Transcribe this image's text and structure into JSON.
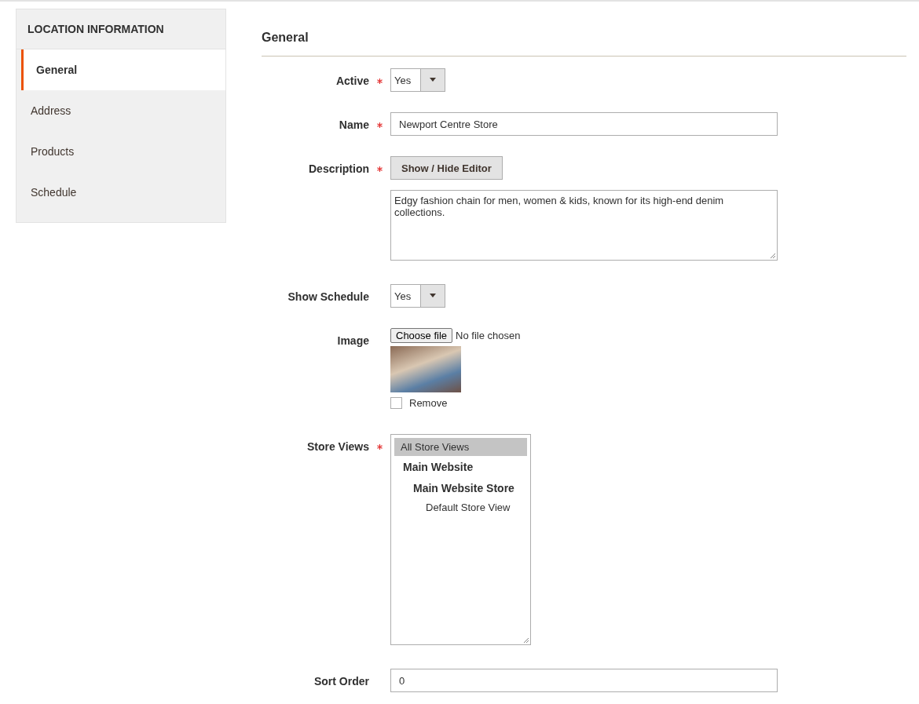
{
  "sidebar": {
    "title": "LOCATION INFORMATION",
    "items": [
      {
        "label": "General",
        "selected": true
      },
      {
        "label": "Address",
        "selected": false
      },
      {
        "label": "Products",
        "selected": false
      },
      {
        "label": "Schedule",
        "selected": false
      }
    ]
  },
  "section": {
    "title": "General"
  },
  "fields": [
    {
      "kind": "select",
      "label": "Active",
      "required": true,
      "value": "Yes"
    },
    {
      "kind": "text",
      "label": "Name",
      "required": true,
      "value": "Newport Centre Store"
    },
    {
      "kind": "editor",
      "label": "Description",
      "required": true,
      "button": "Show / Hide Editor",
      "value": "Edgy fashion chain for men, women & kids, known for its high-end denim collections."
    },
    {
      "kind": "select",
      "label": "Show Schedule",
      "required": false,
      "value": "Yes"
    },
    {
      "kind": "file",
      "label": "Image",
      "required": false,
      "button": "Choose file",
      "status": "No file chosen",
      "remove": {
        "label": "Remove",
        "checked": false
      }
    },
    {
      "kind": "multiselect",
      "label": "Store Views",
      "required": true,
      "options": [
        {
          "kind": "option",
          "label": "All Store Views",
          "selected": true
        },
        {
          "kind": "group",
          "label": "Main Website",
          "children": [
            {
              "kind": "group",
              "label": "Main Website Store",
              "children": [
                {
                  "kind": "option",
                  "label": "Default Store View",
                  "selected": false
                }
              ]
            }
          ]
        }
      ]
    },
    {
      "kind": "text",
      "label": "Sort Order",
      "required": false,
      "value": "0"
    }
  ]
}
